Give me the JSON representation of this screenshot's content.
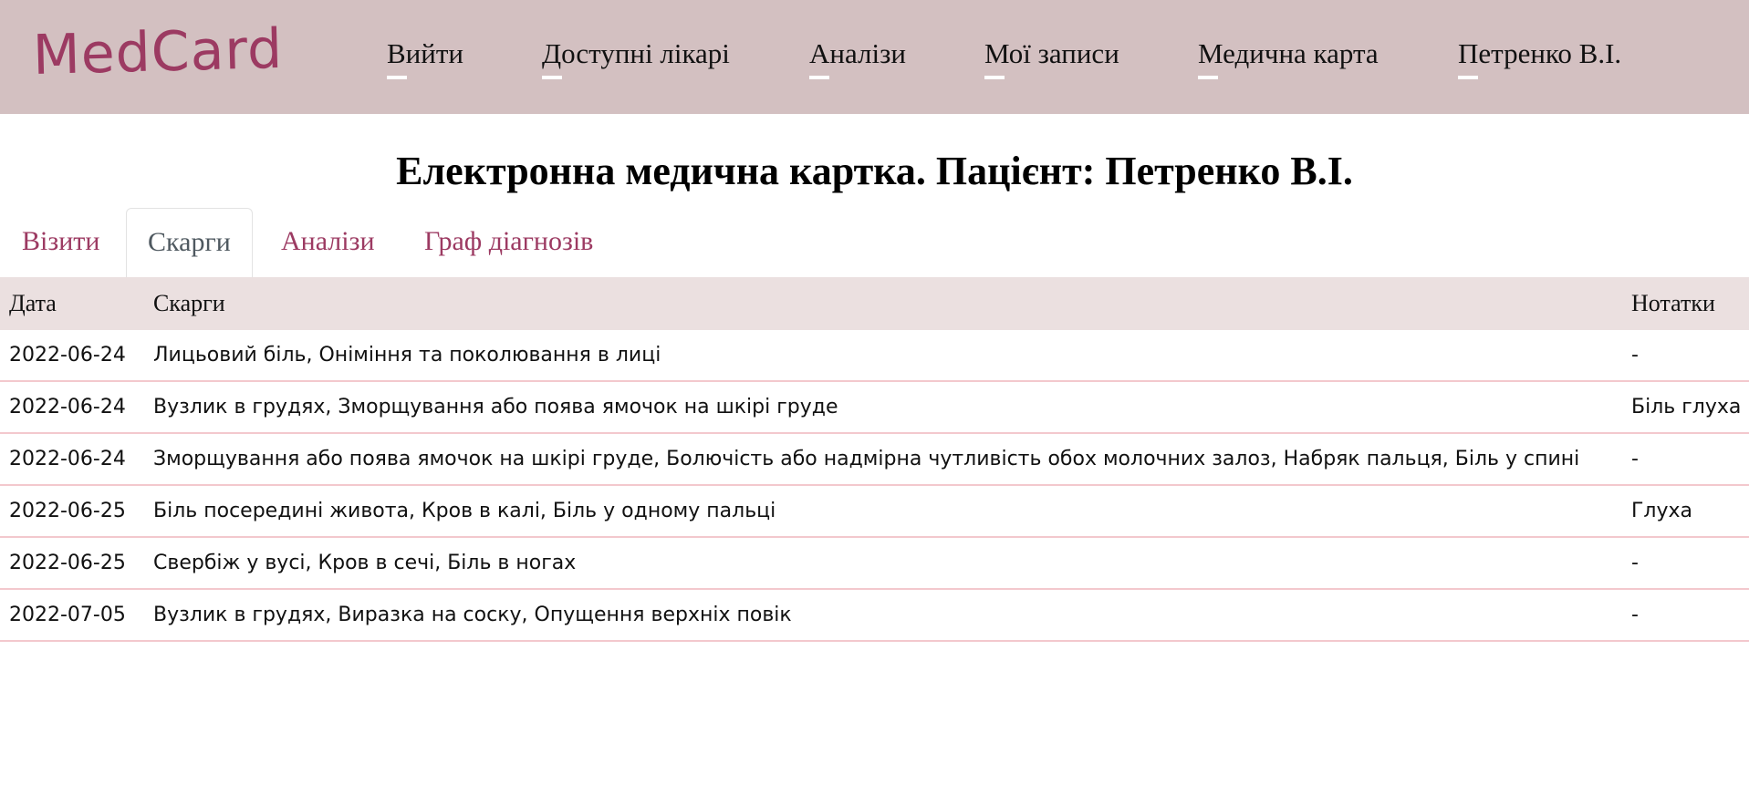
{
  "header": {
    "logo": "MedCard",
    "nav": [
      {
        "label": "Вийти"
      },
      {
        "label": "Доступні лікарі"
      },
      {
        "label": "Аналізи"
      },
      {
        "label": "Мої записи"
      },
      {
        "label": "Медична карта"
      },
      {
        "label": "Петренко В.І."
      }
    ]
  },
  "page": {
    "title": "Електронна медична картка. Пацієнт: Петренко В.І."
  },
  "tabs": [
    {
      "label": "Візити",
      "active": false
    },
    {
      "label": "Скарги",
      "active": true
    },
    {
      "label": "Аналізи",
      "active": false
    },
    {
      "label": "Граф діагнозів",
      "active": false
    }
  ],
  "table": {
    "columns": [
      "Дата",
      "Скарги",
      "Нотатки"
    ],
    "rows": [
      {
        "date": "2022-06-24",
        "complaints": "Лицьовий біль, Оніміння та поколювання в лиці",
        "notes": "-"
      },
      {
        "date": "2022-06-24",
        "complaints": "Вузлик в грудях, Зморщування або поява ямочок на шкірі груде",
        "notes": "Біль глуха"
      },
      {
        "date": "2022-06-24",
        "complaints": "Зморщування або поява ямочок на шкірі груде, Болючість або надмірна чутливість обох молочних залоз, Набряк пальця, Біль у спині",
        "notes": "-"
      },
      {
        "date": "2022-06-25",
        "complaints": "Біль посередині живота, Кров в калі, Біль у одному пальці",
        "notes": "Глуха"
      },
      {
        "date": "2022-06-25",
        "complaints": "Свербіж у вусі, Кров в сечі, Біль в ногах",
        "notes": "-"
      },
      {
        "date": "2022-07-05",
        "complaints": "Вузлик в грудях, Виразка на соску, Опущення верхніх повік",
        "notes": "-"
      }
    ]
  },
  "colors": {
    "header_bg": "#d3c0c1",
    "accent": "#9c3a62",
    "table_head_bg": "#ebe0e0",
    "row_border": "#f3c8cd"
  }
}
